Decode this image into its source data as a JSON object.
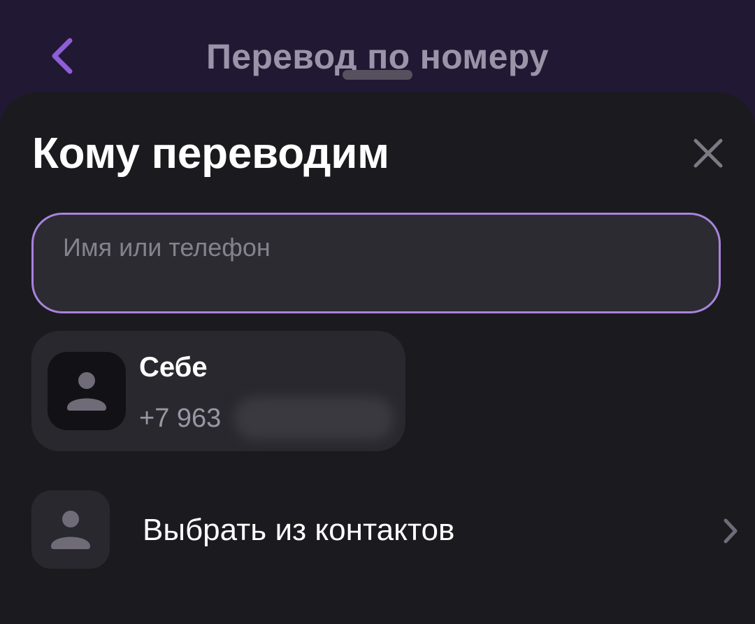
{
  "header": {
    "title": "Перевод по номеру",
    "back_icon": "chevron-left-icon"
  },
  "sheet": {
    "title": "Кому переводим",
    "close_icon": "close-icon",
    "search": {
      "value": "",
      "placeholder": "Имя или телефон"
    },
    "self_card": {
      "name": "Себе",
      "phone": "+7 963",
      "avatar_icon": "person-icon"
    },
    "contacts_row": {
      "label": "Выбрать из контактов",
      "avatar_icon": "person-icon",
      "chevron_icon": "chevron-right-icon"
    }
  },
  "colors": {
    "header_bg": "#211833",
    "sheet_bg": "#1b1a1e",
    "accent": "#a983dc",
    "card_bg": "#29282e",
    "muted_text": "#9a97a4"
  }
}
